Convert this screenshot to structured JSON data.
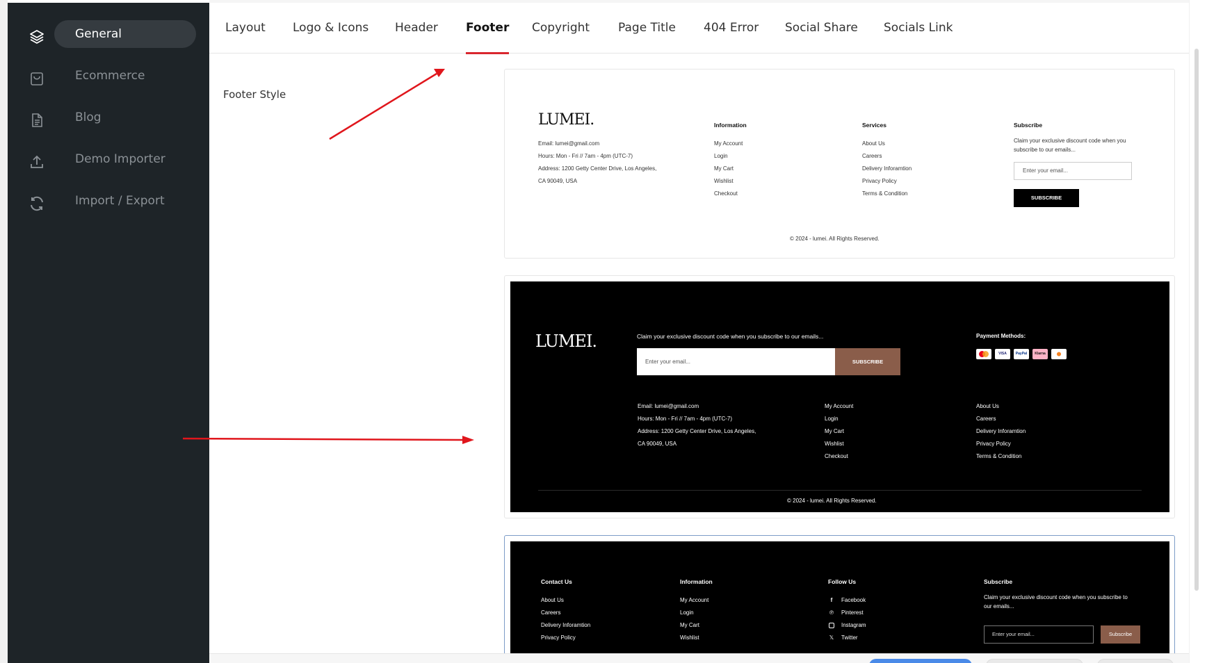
{
  "sidebar": {
    "items": [
      {
        "label": "General",
        "icon": "layers-icon",
        "active": true
      },
      {
        "label": "Ecommerce",
        "icon": "shopping-bag-icon",
        "active": false
      },
      {
        "label": "Blog",
        "icon": "document-icon",
        "active": false
      },
      {
        "label": "Demo Importer",
        "icon": "upload-icon",
        "active": false
      },
      {
        "label": "Import / Export",
        "icon": "refresh-icon",
        "active": false
      }
    ]
  },
  "tabs": [
    {
      "label": "Layout"
    },
    {
      "label": "Logo & Icons"
    },
    {
      "label": "Header"
    },
    {
      "label": "Footer",
      "active": true
    },
    {
      "label": "Copyright"
    },
    {
      "label": "Page Title"
    },
    {
      "label": "404 Error"
    },
    {
      "label": "Social Share"
    },
    {
      "label": "Socials Link"
    }
  ],
  "section": {
    "label": "Footer Style"
  },
  "footer1": {
    "logo": "LUMEI.",
    "contact": [
      "Email: lumei@gmail.com",
      "Hours: Mon - Fri // 7am - 4pm (UTC-7)",
      "Address: 1200 Getty Center Drive, Los Angeles,",
      "CA 90049, USA"
    ],
    "information_title": "Information",
    "information": [
      "My Account",
      "Login",
      "My Cart",
      "Wishlist",
      "Checkout"
    ],
    "services_title": "Services",
    "services": [
      "About Us",
      "Careers",
      "Delivery Inforamtion",
      "Privacy Policy",
      "Terms & Condition"
    ],
    "subscribe_title": "Subscribe",
    "subscribe_text_1": "Claim your exclusive discount code when you",
    "subscribe_text_2": "subscribe to our emails...",
    "email_placeholder": "Enter your email...",
    "subscribe_button": "SUBSCRIBE",
    "copyright": "© 2024 - lumei. All Rights Reserved."
  },
  "footer2": {
    "logo": "LUMEI.",
    "claim_text": "Claim your exclusive discount code when you subscribe to our emails...",
    "email_placeholder": "Enter your email...",
    "subscribe_button": "SUBSCRIBE",
    "payment_title": "Payment Methods:",
    "payments": [
      "mastercard-icon",
      "VISA",
      "PayPal",
      "Klarna",
      "discover-icon"
    ],
    "contact": [
      "Email: lumei@gmail.com",
      "Hours: Mon - Fri // 7am - 4pm (UTC-7)",
      "Address: 1200 Getty Center Drive, Los Angeles,",
      "CA 90049, USA"
    ],
    "links1": [
      "My Account",
      "Login",
      "My Cart",
      "Wishlist",
      "Checkout"
    ],
    "links2": [
      "About Us",
      "Careers",
      "Delivery Inforamtion",
      "Privacy Policy",
      "Terms & Condition"
    ],
    "copyright": "© 2024 - lumei. All Rights Reserved."
  },
  "footer3": {
    "contact_title": "Contact Us",
    "contact": [
      "About Us",
      "Careers",
      "Delivery Inforamtion",
      "Privacy Policy"
    ],
    "information_title": "Information",
    "information": [
      "My Account",
      "Login",
      "My Cart",
      "Wishlist"
    ],
    "follow_title": "Follow Us",
    "follow": [
      {
        "label": "Facebook",
        "icon": "facebook-icon"
      },
      {
        "label": "Pinterest",
        "icon": "pinterest-icon"
      },
      {
        "label": "Instagram",
        "icon": "instagram-icon"
      },
      {
        "label": "Twitter",
        "icon": "x-twitter-icon"
      }
    ],
    "subscribe_title": "Subscribe",
    "subscribe_text_1": "Claim your exclusive discount code when you subscribe to",
    "subscribe_text_2": "our emails...",
    "email_placeholder": "Enter your email...",
    "subscribe_button": "Subscribe"
  },
  "colors": {
    "sidebar": "#1e2428",
    "accent": "#d9262e",
    "brown": "#8a5d4a",
    "arrow": "#e0161c"
  }
}
